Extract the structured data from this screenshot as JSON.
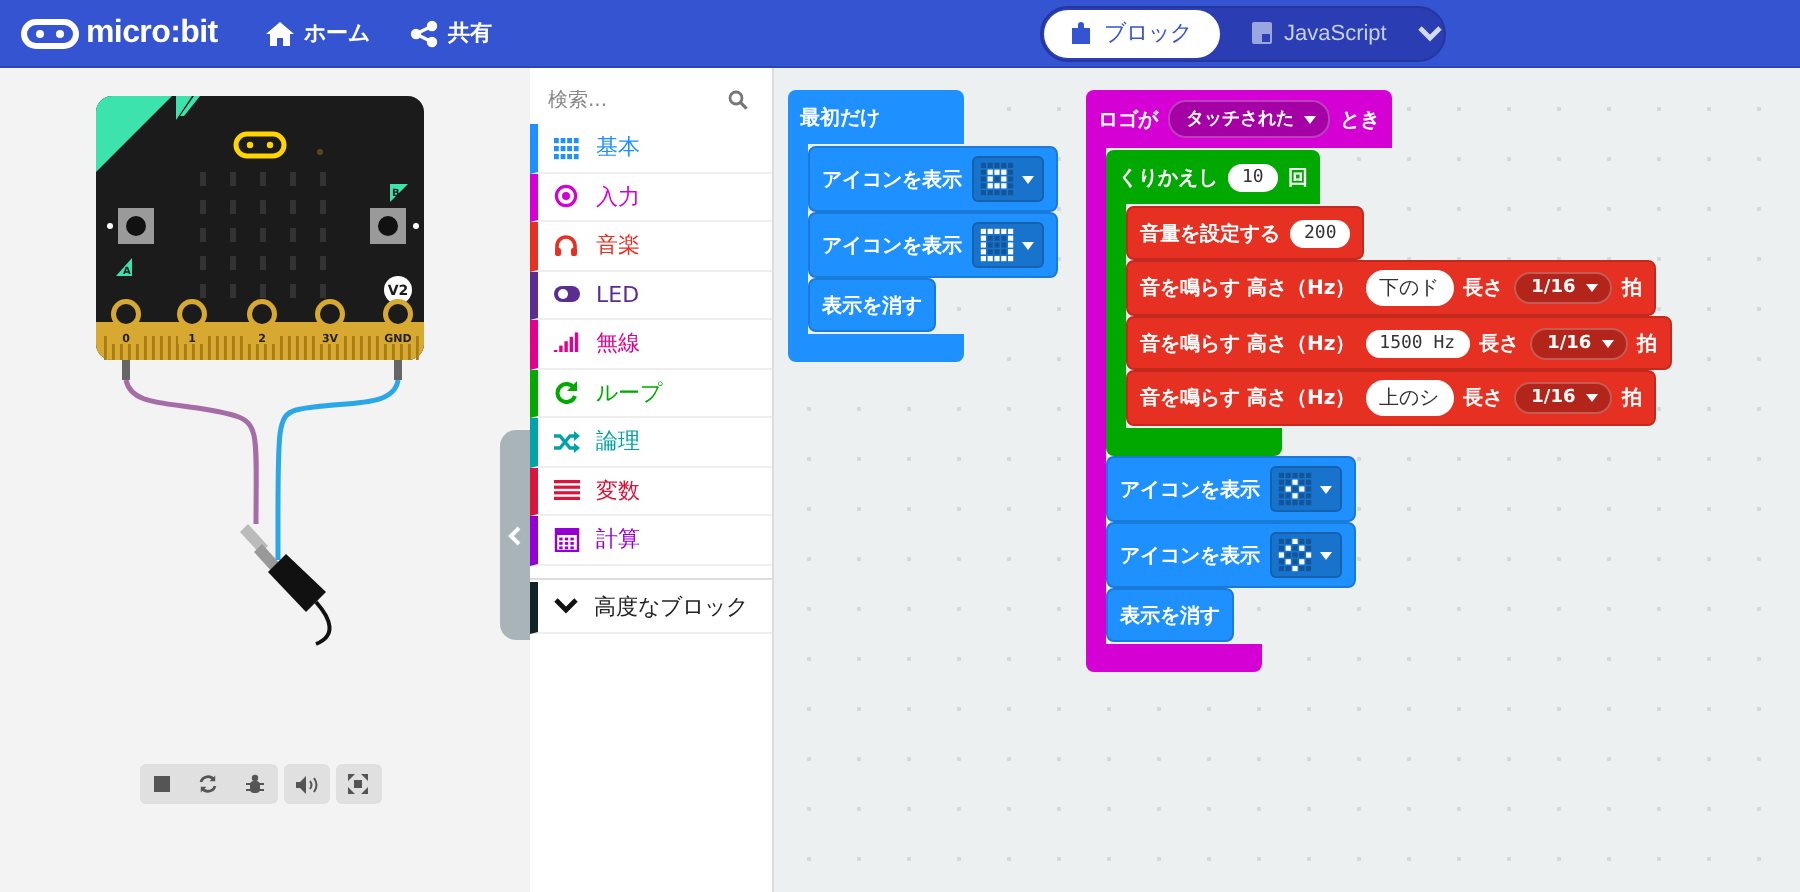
{
  "header": {
    "logo": "micro:bit",
    "nav": [
      {
        "kind": "home",
        "label": "ホーム"
      },
      {
        "kind": "share",
        "label": "共有"
      }
    ],
    "editor_modes": [
      {
        "kind": "blocks",
        "label": "ブロック",
        "selected": true
      },
      {
        "kind": "code",
        "label": "JavaScript",
        "selected": false
      }
    ]
  },
  "simulator": {
    "pins": [
      "0",
      "1",
      "2",
      "3V",
      "GND"
    ],
    "button_a": "A",
    "button_b": "B",
    "version": "V2"
  },
  "toolbox": {
    "search": {
      "placeholder": "検索..."
    },
    "categories": [
      {
        "kind": "basic",
        "label": "基本",
        "color": "#1e90ff"
      },
      {
        "kind": "input",
        "label": "入力",
        "color": "#d400d4"
      },
      {
        "kind": "music",
        "label": "音楽",
        "color": "#e63022"
      },
      {
        "kind": "led",
        "label": "LED",
        "color": "#5c2d91"
      },
      {
        "kind": "radio",
        "label": "無線",
        "color": "#e3008c"
      },
      {
        "kind": "loops",
        "label": "ループ",
        "color": "#00aa00"
      },
      {
        "kind": "logic",
        "label": "論理",
        "color": "#00a4a6"
      },
      {
        "kind": "variables",
        "label": "変数",
        "color": "#dc143c"
      },
      {
        "kind": "math",
        "label": "計算",
        "color": "#9400d3"
      }
    ],
    "advanced": {
      "label": "高度なブロック",
      "color": "#0f2328"
    }
  },
  "workspace": {
    "blocks": [
      {
        "kind": "c",
        "color": "#1e90ff",
        "parts": [
          {
            "kind": "label",
            "text": "最初だけ"
          }
        ],
        "children": [
          {
            "kind": "stmt",
            "color": "#1e90ff",
            "parts": [
              {
                "kind": "label",
                "text": "アイコンを表示"
              },
              {
                "kind": "leds",
                "leds": [
                  [
                    false,
                    false,
                    false,
                    false,
                    false
                  ],
                  [
                    false,
                    true,
                    true,
                    true,
                    false
                  ],
                  [
                    false,
                    true,
                    false,
                    true,
                    false
                  ],
                  [
                    false,
                    true,
                    true,
                    true,
                    false
                  ],
                  [
                    false,
                    false,
                    false,
                    false,
                    false
                  ]
                ]
              }
            ]
          },
          {
            "kind": "stmt",
            "color": "#1e90ff",
            "parts": [
              {
                "kind": "label",
                "text": "アイコンを表示"
              },
              {
                "kind": "leds",
                "leds": [
                  [
                    true,
                    true,
                    true,
                    true,
                    true
                  ],
                  [
                    true,
                    false,
                    false,
                    false,
                    true
                  ],
                  [
                    true,
                    false,
                    false,
                    false,
                    true
                  ],
                  [
                    true,
                    false,
                    false,
                    false,
                    true
                  ],
                  [
                    true,
                    true,
                    true,
                    true,
                    true
                  ]
                ]
              }
            ]
          },
          {
            "kind": "stmt",
            "color": "#1e90ff",
            "parts": [
              {
                "kind": "label",
                "text": "表示を消す"
              }
            ]
          }
        ]
      },
      {
        "kind": "c",
        "color": "#d400d4",
        "parts": [
          {
            "kind": "label",
            "text": "ロゴが"
          },
          {
            "kind": "dropdown",
            "text": "タッチされた"
          },
          {
            "kind": "label",
            "text": "とき"
          }
        ],
        "children": [
          {
            "kind": "c",
            "color": "#00a800",
            "parts": [
              {
                "kind": "label",
                "text": "くりかえし"
              },
              {
                "kind": "number",
                "text": "10"
              },
              {
                "kind": "label",
                "text": "回"
              }
            ],
            "children": [
              {
                "kind": "stmt",
                "color": "#e63022",
                "parts": [
                  {
                    "kind": "label",
                    "text": "音量を設定する"
                  },
                  {
                    "kind": "number",
                    "text": "200"
                  }
                ]
              },
              {
                "kind": "stmt",
                "color": "#e63022",
                "parts": [
                  {
                    "kind": "label",
                    "text": "音を鳴らす 高さ（Hz）"
                  },
                  {
                    "kind": "text",
                    "text": "下のド"
                  },
                  {
                    "kind": "label",
                    "text": "長さ"
                  },
                  {
                    "kind": "dropdown",
                    "text": "1/16"
                  },
                  {
                    "kind": "label",
                    "text": "拍"
                  }
                ]
              },
              {
                "kind": "stmt",
                "color": "#e63022",
                "parts": [
                  {
                    "kind": "label",
                    "text": "音を鳴らす 高さ（Hz）"
                  },
                  {
                    "kind": "number",
                    "text": "1500 Hz"
                  },
                  {
                    "kind": "label",
                    "text": "長さ"
                  },
                  {
                    "kind": "dropdown",
                    "text": "1/16"
                  },
                  {
                    "kind": "label",
                    "text": "拍"
                  }
                ]
              },
              {
                "kind": "stmt",
                "color": "#e63022",
                "parts": [
                  {
                    "kind": "label",
                    "text": "音を鳴らす 高さ（Hz）"
                  },
                  {
                    "kind": "text",
                    "text": "上のシ"
                  },
                  {
                    "kind": "label",
                    "text": "長さ"
                  },
                  {
                    "kind": "dropdown",
                    "text": "1/16"
                  },
                  {
                    "kind": "label",
                    "text": "拍"
                  }
                ]
              }
            ]
          },
          {
            "kind": "stmt",
            "color": "#1e90ff",
            "parts": [
              {
                "kind": "label",
                "text": "アイコンを表示"
              },
              {
                "kind": "leds",
                "leds": [
                  [
                    false,
                    false,
                    false,
                    false,
                    false
                  ],
                  [
                    false,
                    false,
                    true,
                    false,
                    false
                  ],
                  [
                    false,
                    true,
                    false,
                    true,
                    false
                  ],
                  [
                    false,
                    false,
                    true,
                    false,
                    false
                  ],
                  [
                    false,
                    false,
                    false,
                    false,
                    false
                  ]
                ]
              }
            ]
          },
          {
            "kind": "stmt",
            "color": "#1e90ff",
            "parts": [
              {
                "kind": "label",
                "text": "アイコンを表示"
              },
              {
                "kind": "leds",
                "leds": [
                  [
                    false,
                    false,
                    true,
                    false,
                    false
                  ],
                  [
                    false,
                    true,
                    false,
                    true,
                    false
                  ],
                  [
                    true,
                    false,
                    false,
                    false,
                    true
                  ],
                  [
                    false,
                    true,
                    false,
                    true,
                    false
                  ],
                  [
                    false,
                    false,
                    true,
                    false,
                    false
                  ]
                ]
              }
            ]
          },
          {
            "kind": "stmt",
            "color": "#1e90ff",
            "parts": [
              {
                "kind": "label",
                "text": "表示を消す"
              }
            ]
          }
        ]
      }
    ]
  }
}
